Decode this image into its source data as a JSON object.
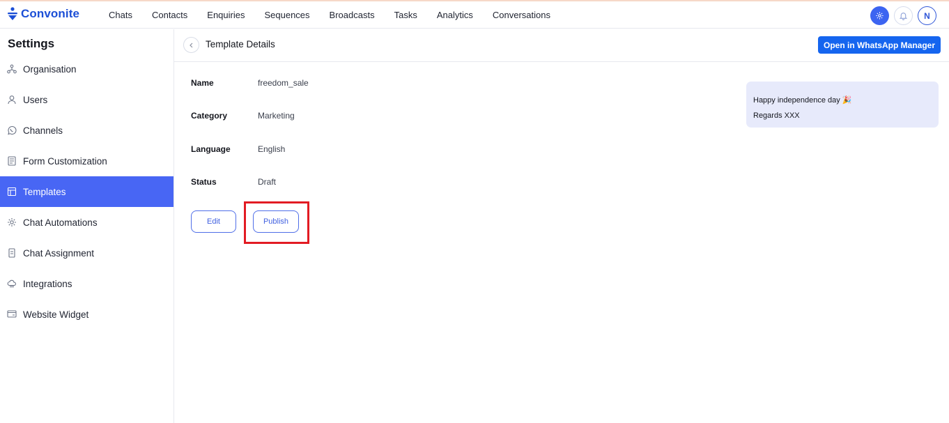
{
  "brand": {
    "name": "Convonite",
    "color": "#1c4fd6"
  },
  "nav": {
    "items": [
      "Chats",
      "Contacts",
      "Enquiries",
      "Sequences",
      "Broadcasts",
      "Tasks",
      "Analytics",
      "Conversations"
    ],
    "avatar_initial": "N",
    "icons": [
      "gear-icon",
      "bell-icon"
    ]
  },
  "sidebar": {
    "title": "Settings",
    "items": [
      {
        "label": "Organisation",
        "icon": "organisation-icon"
      },
      {
        "label": "Users",
        "icon": "user-icon"
      },
      {
        "label": "Channels",
        "icon": "whatsapp-icon"
      },
      {
        "label": "Form Customization",
        "icon": "form-icon"
      },
      {
        "label": "Templates",
        "icon": "template-icon",
        "active": true
      },
      {
        "label": "Chat Automations",
        "icon": "automation-icon"
      },
      {
        "label": "Chat Assignment",
        "icon": "assignment-icon"
      },
      {
        "label": "Integrations",
        "icon": "integrations-icon"
      },
      {
        "label": "Website Widget",
        "icon": "widget-icon"
      }
    ],
    "active_color": "#4866f4"
  },
  "header": {
    "title": "Template Details",
    "whatsapp_button": "Open in WhatsApp Manager"
  },
  "details": {
    "fields": [
      {
        "label": "Name",
        "value": "freedom_sale"
      },
      {
        "label": "Category",
        "value": "Marketing"
      },
      {
        "label": "Language",
        "value": "English"
      },
      {
        "label": "Status",
        "value": "Draft"
      }
    ],
    "edit_label": "Edit",
    "publish_label": "Publish"
  },
  "preview": {
    "line1": "Happy independence day 🎉",
    "line2": "Regards XXX"
  },
  "colors": {
    "primary": "#1565ef",
    "highlight": "#e21b23",
    "preview_bg": "#e7eafb"
  }
}
